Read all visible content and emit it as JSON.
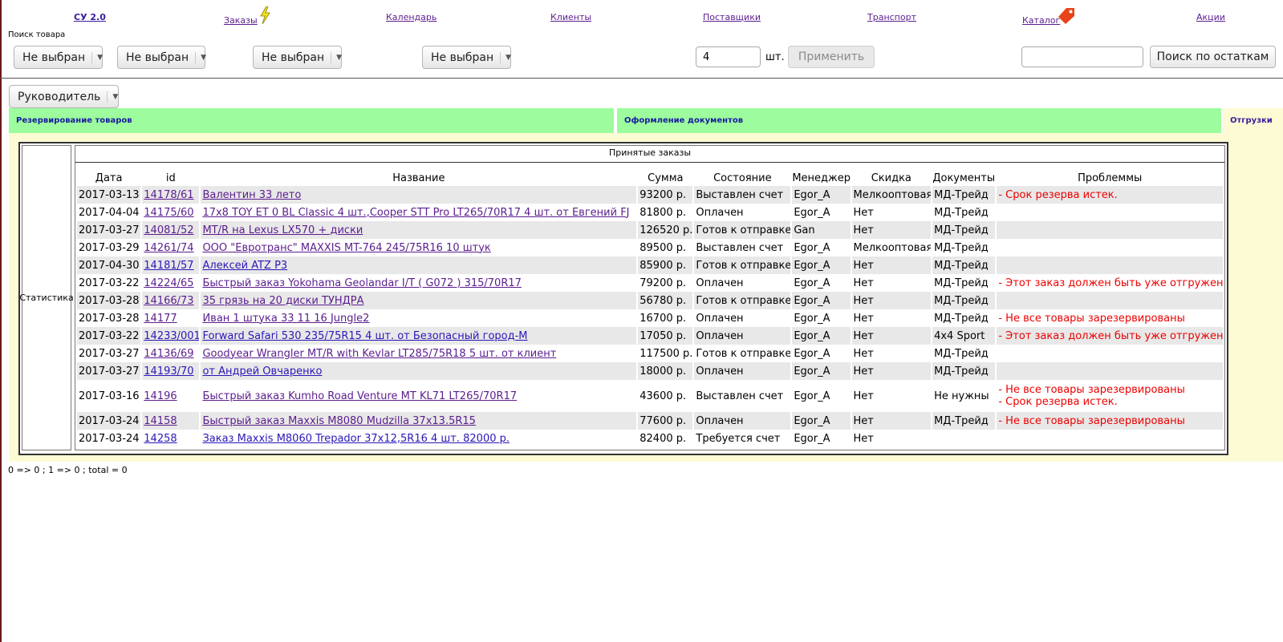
{
  "nav": {
    "brand": "СУ 2.0",
    "orders": "Заказы",
    "calendar": "Календарь",
    "clients": "Клиенты",
    "suppliers": "Поставщики",
    "transport": "Транспорт",
    "catalog": "Каталог",
    "promos": "Акции"
  },
  "search": {
    "label": "Поиск товара",
    "dropdowns": [
      "Не выбран",
      "Не выбран",
      "Не выбран",
      "Не выбран"
    ],
    "qty_value": "4",
    "qty_unit": "шт.",
    "apply_label": "Применить",
    "stock_value": "",
    "stock_button": "Поиск по остаткам"
  },
  "role": {
    "selected": "Руководитель"
  },
  "tabs": {
    "reserve": "Резервирование товаров",
    "documents": "Оформление документов",
    "shipments": "Отгрузки"
  },
  "stats_label": "Статистика",
  "table": {
    "title": "Принятые заказы",
    "headers": [
      "Дата",
      "id",
      "Название",
      "Сумма",
      "Состояние",
      "Менеджер",
      "Скидка",
      "Документы",
      "Проблеммы"
    ],
    "rows": [
      {
        "date": "2017-03-13",
        "id": "14178/61",
        "name": "Валентин 33 лето",
        "sum": "93200 р.",
        "state": "Выставлен счет",
        "manager": "Egor_A",
        "discount": "Мелкооптовая",
        "docs": "МД-Трейд",
        "problems": [
          "- Срок резерва истек."
        ],
        "visited": true
      },
      {
        "date": "2017-04-04",
        "id": "14175/60",
        "name": "17x8 TOY ET 0 BL Classic 4 шт.,Cooper STT Pro LT265/70R17 4 шт. от Евгений FJ",
        "sum": "81800 р.",
        "state": "Оплачен",
        "manager": "Egor_A",
        "discount": "Нет",
        "docs": "МД-Трейд",
        "problems": [],
        "visited": true
      },
      {
        "date": "2017-03-27",
        "id": "14081/52",
        "name": "MT/R на Lexus LX570 + диски",
        "sum": "126520 р.",
        "state": "Готов к отправке",
        "manager": "Gan",
        "discount": "Нет",
        "docs": "МД-Трейд",
        "problems": [],
        "visited": true
      },
      {
        "date": "2017-03-29",
        "id": "14261/74",
        "name": "ООО \"Евротранс\" MAXXIS MT-764 245/75R16 10 штук",
        "sum": "89500 р.",
        "state": "Выставлен счет",
        "manager": "Egor_A",
        "discount": "Мелкооптовая",
        "docs": "МД-Трейд",
        "problems": [],
        "visited": true
      },
      {
        "date": "2017-04-30",
        "id": "14181/57",
        "name": "Алексей ATZ P3",
        "sum": "85900 р.",
        "state": "Готов к отправке",
        "manager": "Egor_A",
        "discount": "Нет",
        "docs": "МД-Трейд",
        "problems": [],
        "visited": false
      },
      {
        "date": "2017-03-22",
        "id": "14224/65",
        "name": "Быстрый заказ Yokohama Geolandar I/T ( G072 ) 315/70R17",
        "sum": "79200 р.",
        "state": "Оплачен",
        "manager": "Egor_A",
        "discount": "Нет",
        "docs": "МД-Трейд",
        "problems": [
          "- Этот заказ должен быть уже отгружен."
        ],
        "visited": true
      },
      {
        "date": "2017-03-28",
        "id": "14166/73",
        "name": "35 грязь на 20 диски ТУНДРА",
        "sum": "56780 р.",
        "state": "Готов к отправке",
        "manager": "Egor_A",
        "discount": "Нет",
        "docs": "МД-Трейд",
        "problems": [],
        "visited": true
      },
      {
        "date": "2017-03-28",
        "id": "14177",
        "name": "Иван 1 штука 33 11 16 Jungle2",
        "sum": "16700 р.",
        "state": "Оплачен",
        "manager": "Egor_A",
        "discount": "Нет",
        "docs": "МД-Трейд",
        "problems": [
          "- Не все товары зарезервированы"
        ],
        "visited": true
      },
      {
        "date": "2017-03-22",
        "id": "14233/001",
        "name": "Forward Safari 530 235/75R15 4 шт. от Безопасный город-М",
        "sum": "17050 р.",
        "state": "Оплачен",
        "manager": "Egor_A",
        "discount": "Нет",
        "docs": "4x4 Sport",
        "problems": [
          "- Этот заказ должен быть уже отгружен."
        ],
        "visited": false
      },
      {
        "date": "2017-03-27",
        "id": "14136/69",
        "name": "Goodyear Wrangler MT/R with Kevlar LT285/75R18 5 шт. от клиент",
        "sum": "117500 р.",
        "state": "Готов к отправке",
        "manager": "Egor_A",
        "discount": "Нет",
        "docs": "МД-Трейд",
        "problems": [],
        "visited": true
      },
      {
        "date": "2017-03-27",
        "id": "14193/70",
        "name": "от Андрей Овчаренко",
        "sum": "18000 р.",
        "state": "Оплачен",
        "manager": "Egor_A",
        "discount": "Нет",
        "docs": "МД-Трейд",
        "problems": [],
        "visited": false
      },
      {
        "date": "2017-03-16",
        "id": "14196",
        "name": "Быстрый заказ Kumho Road Venture MT KL71 LT265/70R17",
        "sum": "43600 р.",
        "state": "Выставлен счет",
        "manager": "Egor_A",
        "discount": "Нет",
        "docs": "Не нужны",
        "problems": [
          "- Не все товары зарезервированы",
          "- Срок резерва истек."
        ],
        "visited": true
      },
      {
        "date": "2017-03-24",
        "id": "14158",
        "name": "Быстрый заказ Maxxis M8080 Mudzilla 37x13.5R15",
        "sum": "77600 р.",
        "state": "Оплачен",
        "manager": "Egor_A",
        "discount": "Нет",
        "docs": "МД-Трейд",
        "problems": [
          "- Не все товары зарезервированы"
        ],
        "visited": true
      },
      {
        "date": "2017-03-24",
        "id": "14258",
        "name": "Заказ Maxxis M8060 Trepador 37x12,5R16 4 шт. 82000 р.",
        "sum": "82400 р.",
        "state": "Требуется счет",
        "manager": "Egor_A",
        "discount": "Нет",
        "docs": "",
        "problems": [],
        "visited": false
      }
    ]
  },
  "footer": "0 => 0 ; 1 => 0 ; total = 0",
  "colors": {
    "tab_green": "#9dfc9d",
    "panel_yellow": "#fdfbd4",
    "problem_red": "#ee0000",
    "link_blue": "#2a18b8",
    "link_visited": "#5b1d8e"
  }
}
